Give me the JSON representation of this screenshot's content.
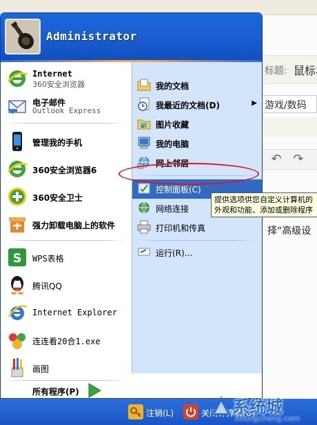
{
  "background_page": {
    "title_label": "标题:",
    "title_value": "鼠标右",
    "category": "游戏/数码",
    "body_text": "择“高级设"
  },
  "start_menu": {
    "user_name": "Administrator",
    "pinned": [
      {
        "title": "Internet",
        "subtitle": "360安全浏览器",
        "icon": "ie-icon"
      },
      {
        "title": "电子邮件",
        "subtitle": "Outlook Express",
        "icon": "mail-icon"
      }
    ],
    "recent": [
      {
        "label": "管理我的手机",
        "icon": "phone-icon"
      },
      {
        "label": "360安全浏览器6",
        "icon": "browser-360-icon"
      },
      {
        "label": "360安全卫士",
        "icon": "guard-360-icon"
      },
      {
        "label": "强力卸载电脑上的软件",
        "icon": "uninstall-icon"
      },
      {
        "label": "WPS表格",
        "icon": "wps-icon"
      },
      {
        "label": "腾讯QQ",
        "icon": "qq-icon"
      },
      {
        "label": "Internet Explorer",
        "icon": "ie-icon"
      },
      {
        "label": "连连看20合1.exe",
        "icon": "game-icon"
      },
      {
        "label": "画图",
        "icon": "paint-icon"
      }
    ],
    "all_programs": "所有程序(P)",
    "right": {
      "my_documents": "我的文档",
      "recent_documents": "我最近的文档(D)",
      "my_pictures": "图片收藏",
      "my_computer": "我的电脑",
      "network_places": "网上邻居",
      "control_panel": "控制面板(C)",
      "network_connections": "网络连接",
      "printers": "打印机和传真",
      "run": "运行(R)..."
    },
    "tooltip": "提供选项供您自定义计算机的外观和功能、添加或删除程序以及设置网络连接和用户帐户。",
    "footer": {
      "logoff": "注销(L)",
      "shutdown": "关闭计算机(U)"
    }
  },
  "watermark": {
    "text": "系统城",
    "url": "xitongcheng.com"
  },
  "colors": {
    "xp_blue": "#1c5fd2",
    "right_pane": "#d3e5fa",
    "highlight": "#316ac5",
    "annotation_red": "#e0161e"
  }
}
